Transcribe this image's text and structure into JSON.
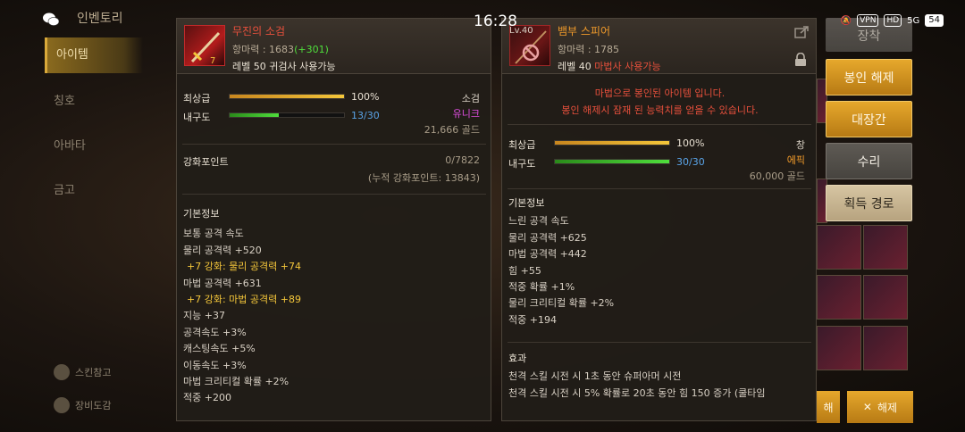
{
  "status": {
    "time": "16:28",
    "vpn": "VPN",
    "hd": "HD",
    "signal": "5G",
    "battery": "54"
  },
  "background": {
    "title": "인벤토리",
    "menu": [
      "아이템",
      "칭호",
      "아바타",
      "금고"
    ],
    "bottom": [
      "스킨참고",
      "장비도감"
    ]
  },
  "left_item": {
    "name": "무진의 소검",
    "power_label": "항마력 : 1683",
    "power_bonus": "(+301)",
    "requirement": "레벨 50 귀검사 사용가능",
    "grade_label": "최상급",
    "grade_pct": "100%",
    "grade_value": 1.0,
    "durability_label": "내구도",
    "durability": "13/30",
    "durability_value": 0.4333,
    "type": "소검",
    "rarity": "유니크",
    "price": "21,666 골드",
    "enhance_label": "강화포인트",
    "enhance_value": "0/7822",
    "enhance_total": "(누적 강화포인트: 13843)",
    "basic_title": "기본정보",
    "stats": [
      {
        "text": "보통 공격 속도",
        "enh": false
      },
      {
        "text": "물리 공격력 +520",
        "enh": false
      },
      {
        "text": "+7 강화: 물리 공격력 +74",
        "enh": true
      },
      {
        "text": "마법 공격력 +631",
        "enh": false
      },
      {
        "text": "+7 강화: 마법 공격력 +89",
        "enh": true
      },
      {
        "text": "지능 +37",
        "enh": false
      },
      {
        "text": "공격속도 +3%",
        "enh": false
      },
      {
        "text": "캐스팅속도 +5%",
        "enh": false
      },
      {
        "text": "이동속도 +3%",
        "enh": false
      },
      {
        "text": "마법 크리티컬 확률 +2%",
        "enh": false
      },
      {
        "text": "적중 +200",
        "enh": false
      }
    ]
  },
  "right_item": {
    "level": "Lv.40",
    "name": "뱀부 스피어",
    "power_label": "항마력 : 1785",
    "req_level": "레벨 40",
    "req_class": "마법사 사용가능",
    "sealed_line1": "마법으로 봉인된 아이템 입니다.",
    "sealed_line2": "봉인 해제시 잠재 된 능력치를 얻을 수 있습니다.",
    "grade_label": "최상급",
    "grade_pct": "100%",
    "grade_value": 1.0,
    "durability_label": "내구도",
    "durability": "30/30",
    "durability_value": 1.0,
    "type": "창",
    "rarity": "에픽",
    "price": "60,000 골드",
    "basic_title": "기본정보",
    "stats": [
      "느린 공격 속도",
      "물리 공격력 +625",
      "마법 공격력 +442",
      "힘 +55",
      "적중 확률 +1%",
      "물리 크리티컬 확률 +2%",
      "적중 +194"
    ],
    "effect_title": "효과",
    "effects": [
      "천격 스킬 시전 시 1초 동안 슈퍼아머 시전",
      "천격 스킬 시전 시 5% 확률로 20초 동안 힘 150 증가 (쿨타임"
    ]
  },
  "actions": {
    "equip": "장착",
    "unseal": "봉인 해제",
    "smith": "대장간",
    "repair": "수리",
    "acquire": "획득 경로",
    "bottom_left": "해",
    "bottom_right": "해제"
  },
  "colors": {
    "gold_button": "#e6a82c",
    "unique": "#e04ee0",
    "epic": "#f09a2a",
    "item_name": "#e8503c"
  }
}
